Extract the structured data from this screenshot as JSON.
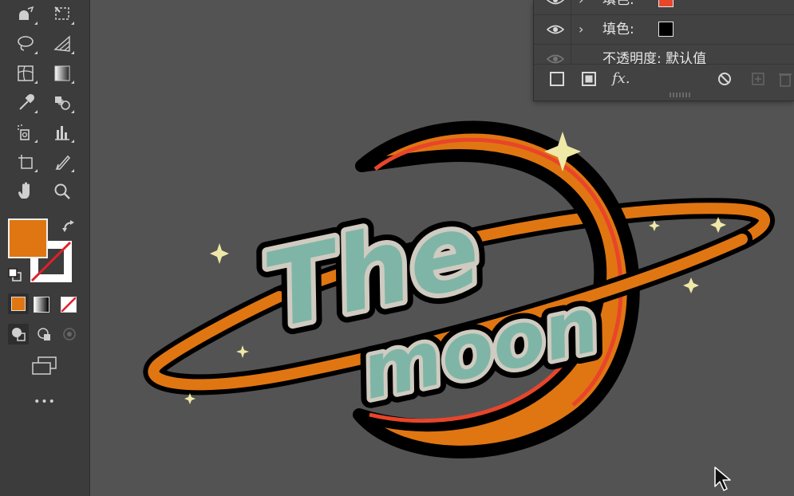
{
  "colors": {
    "fill": "#e07612",
    "stroke_none": "#ffffff",
    "moon": "#e07612",
    "moon_rim": "#e8452a",
    "text_fill": "#7fb5a7",
    "text_outline": "#cfcbc0",
    "sparkle": "#efe9a8",
    "ring": "#e07612",
    "panel_swatch_1": "#e8452a",
    "panel_swatch_2": "#000000"
  },
  "toolbar": {
    "tools": [
      {
        "name": "shape-builder-icon"
      },
      {
        "name": "free-transform-icon"
      },
      {
        "name": "lasso-icon"
      },
      {
        "name": "perspective-grid-icon"
      },
      {
        "name": "mesh-icon"
      },
      {
        "name": "gradient-icon"
      },
      {
        "name": "eyedropper-icon"
      },
      {
        "name": "blend-icon"
      },
      {
        "name": "symbol-sprayer-icon"
      },
      {
        "name": "column-graph-icon"
      },
      {
        "name": "artboard-icon"
      },
      {
        "name": "slice-icon"
      },
      {
        "name": "hand-icon"
      },
      {
        "name": "zoom-icon"
      }
    ],
    "more_label": "•••"
  },
  "appearance_panel": {
    "rows": [
      {
        "label": "填色:",
        "swatch": "#e8452a"
      },
      {
        "label": "填色:",
        "swatch": "#000000"
      },
      {
        "label": "不透明度: 默认值"
      }
    ],
    "fx_label": "fx."
  },
  "artwork": {
    "word1": "The",
    "word2": "moon"
  }
}
